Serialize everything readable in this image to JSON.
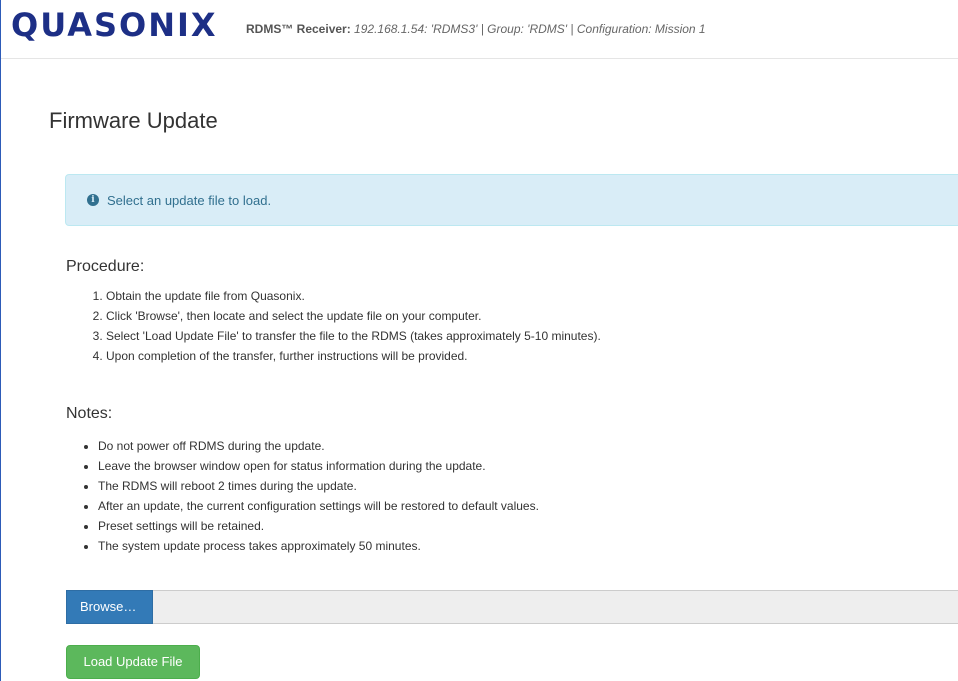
{
  "header": {
    "logo_text": "QUASONIX",
    "receiver_label": "RDMS™ Receiver:",
    "receiver_info": "192.168.1.54: 'RDMS3' | Group: 'RDMS' | Configuration: Mission 1"
  },
  "page": {
    "title": "Firmware Update"
  },
  "alert": {
    "icon": "info-circle-icon",
    "text": "Select an update file to load.",
    "color": "#31708f",
    "background": "#d9edf7"
  },
  "procedure": {
    "heading": "Procedure:",
    "steps": [
      "Obtain the update file from Quasonix.",
      "Click 'Browse', then locate and select the update file on your computer.",
      "Select 'Load Update File' to transfer the file to the RDMS (takes approximately 5-10 minutes).",
      "Upon completion of the transfer, further instructions will be provided."
    ]
  },
  "notes": {
    "heading": "Notes:",
    "items": [
      "Do not power off RDMS during the update.",
      "Leave the browser window open for status information during the update.",
      "The RDMS will reboot 2 times during the update.",
      "After an update, the current configuration settings will be restored to default values.",
      "Preset settings will be retained.",
      "The system update process takes approximately 50 minutes."
    ]
  },
  "file_input": {
    "browse_label": "Browse…",
    "browse_color": "#337ab7"
  },
  "actions": {
    "load_label": "Load Update File",
    "load_color": "#5cb85c"
  }
}
